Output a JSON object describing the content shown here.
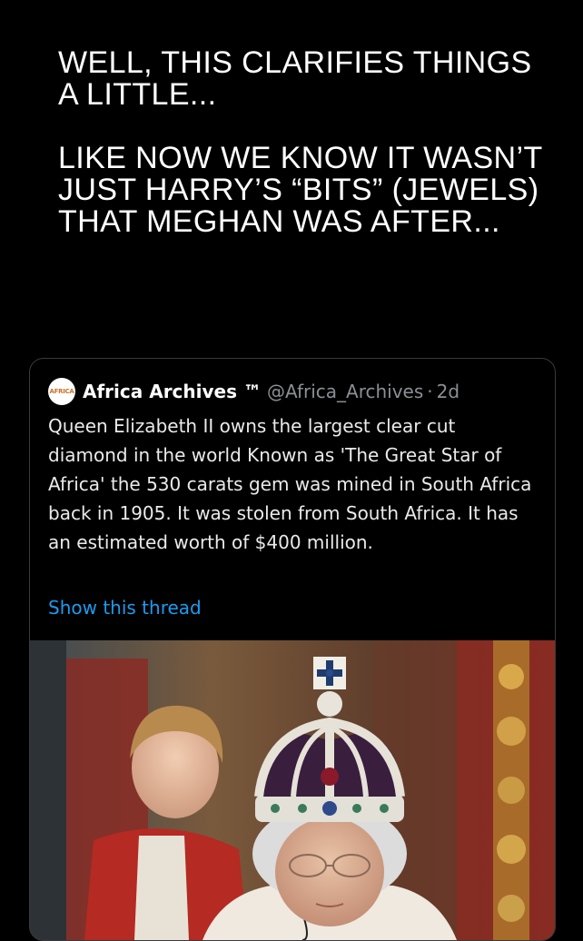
{
  "caption": {
    "paragraph_1": "WELL, THIS CLARIFIES THINGS A LITTLE...",
    "paragraph_2": "LIKE NOW WE KNOW IT WASN’T JUST HARRY’S “BITS” (JEWELS) THAT MEGHAN WAS AFTER..."
  },
  "tweet": {
    "avatar_text": "AFRICA",
    "display_name": "Africa Archives ™",
    "handle": "@Africa_Archives",
    "separator": "·",
    "time": "2d",
    "body": "Queen Elizabeth II owns the largest clear cut diamond in the world Known as 'The Great Star of Africa' the 530 carats gem was mined in South Africa back in 1905. It was stolen from South Africa. It has an estimated worth of $400 million.",
    "show_thread": "Show this thread",
    "link_color": "#1d9bf0"
  },
  "photo": {
    "subject": "crown-photo"
  }
}
